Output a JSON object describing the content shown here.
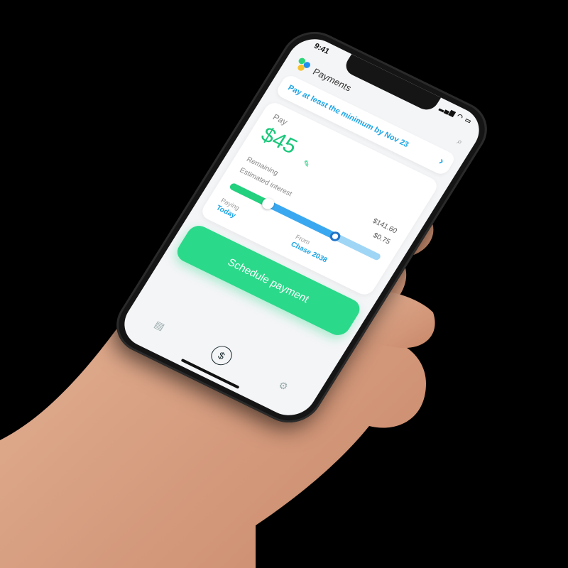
{
  "status_bar": {
    "time": "9:41",
    "system_icons": "▂▄▆ ◠ ▭"
  },
  "header": {
    "title": "Payments",
    "search_icon": "search-icon",
    "logo_icon": "app-logo-icon"
  },
  "banner": {
    "text": "Pay at least the minimum by Nov 23",
    "chevron": "›"
  },
  "payment_card": {
    "pay_label": "Pay",
    "amount": "$45",
    "edit_icon": "✎",
    "remaining_label": "Remaining",
    "remaining_value": "$141.60",
    "interest_label": "Estimated interest",
    "interest_value": "$0.75",
    "paying_label": "Paying",
    "paying_value": "Today",
    "from_label": "From",
    "from_value": "Chase 2038"
  },
  "cta": {
    "label": "Schedule payment"
  },
  "tabs": [
    {
      "icon": "list-icon",
      "glyph": "▤"
    },
    {
      "icon": "payments-icon",
      "glyph": "$"
    },
    {
      "icon": "settings-icon",
      "glyph": "⚙"
    }
  ],
  "colors": {
    "accent_green": "#2bd98a",
    "accent_blue": "#1fa5e6"
  }
}
